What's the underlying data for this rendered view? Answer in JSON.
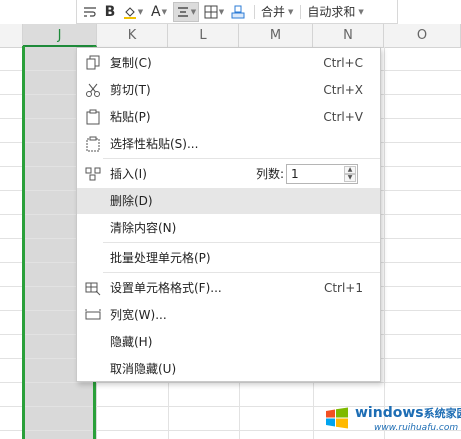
{
  "toolbar": {
    "bold_label": "B",
    "font_color_label": "A",
    "merge_label": "合并",
    "autosum_label": "自动求和"
  },
  "columns": [
    "J",
    "K",
    "L",
    "M",
    "N",
    "O"
  ],
  "selected_column": "J",
  "menu": {
    "copy": {
      "label": "复制(C)",
      "shortcut": "Ctrl+C"
    },
    "cut": {
      "label": "剪切(T)",
      "shortcut": "Ctrl+X"
    },
    "paste": {
      "label": "粘贴(P)",
      "shortcut": "Ctrl+V"
    },
    "paste_special": {
      "label": "选择性粘贴(S)..."
    },
    "insert": {
      "label": "插入(I)",
      "count_label": "列数:",
      "count_value": "1"
    },
    "delete": {
      "label": "删除(D)"
    },
    "clear": {
      "label": "清除内容(N)"
    },
    "batch": {
      "label": "批量处理单元格(P)"
    },
    "format_cells": {
      "label": "设置单元格格式(F)...",
      "shortcut": "Ctrl+1"
    },
    "col_width": {
      "label": "列宽(W)..."
    },
    "hide": {
      "label": "隐藏(H)"
    },
    "unhide": {
      "label": "取消隐藏(U)"
    }
  },
  "watermark": {
    "title": "windows",
    "title_cn": "系统家园",
    "url": "www.ruihuafu.com"
  },
  "colors": {
    "selection_green": "#2aa03a",
    "hover_gray": "#e6e6e6",
    "watermark_blue": "#1d6db4"
  }
}
